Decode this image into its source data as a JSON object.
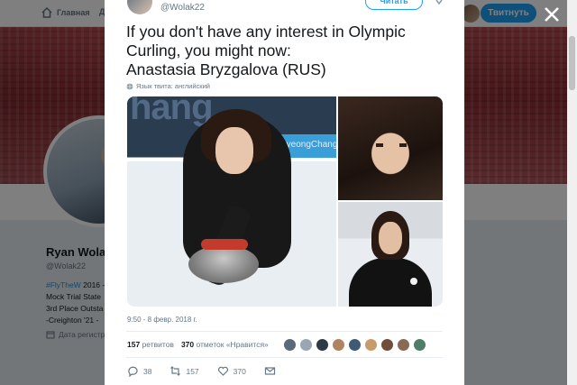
{
  "nav": {
    "home_label": "Главная",
    "cut_label": "Д",
    "tweet_button": "Твитнуть"
  },
  "profile": {
    "name": "Ryan Wola",
    "handle": "@Wolak22",
    "bio_tag": "#FlyTheW",
    "bio_lines": [
      "2016 -",
      "Mock Trial State",
      "3rd Place Outsta",
      "-Creighton '21 -"
    ],
    "joined": "Дата регистр"
  },
  "tweet": {
    "handle": "@Wolak22",
    "follow_label": "Читать",
    "text_lines": [
      "If you don't have any interest in Olympic",
      "Curling, you might now:",
      "Anastasia Bryzgalova (RUS)"
    ],
    "language": "Язык твита: английский",
    "photo_brand": "hang",
    "photo_city": "PyeongChang",
    "timestamp": "9:50 - 8 февр. 2018 г.",
    "retweets_count": "157",
    "retweets_label": "ретвитов",
    "likes_count": "370",
    "likes_label": "отметок «Нравится»",
    "reply_count": "38",
    "retweet_count": "157",
    "like_count": "370"
  },
  "colors": {
    "accent": "#1da1f2",
    "text": "#14171a",
    "muted": "#657786"
  },
  "likers": [
    "#5b6a78",
    "#9aa6b3",
    "#2e3a46",
    "#b08463",
    "#3e5a74",
    "#c79b6b",
    "#6f4e3b",
    "#8a6a52",
    "#4f7d6a"
  ]
}
